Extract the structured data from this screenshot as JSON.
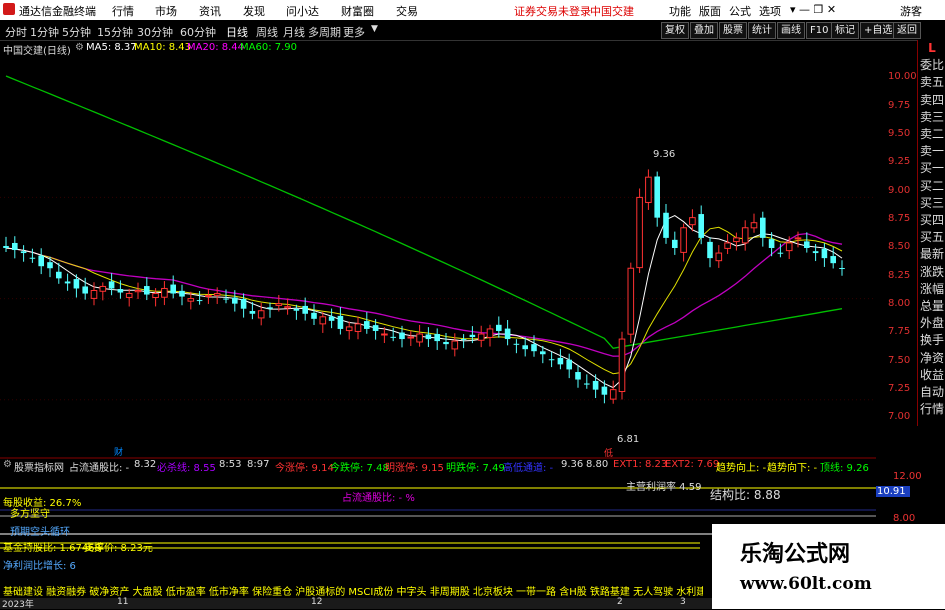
{
  "titlebar": {
    "app_name": "通达信金融终端",
    "menu": [
      "行情",
      "市场",
      "资讯",
      "发现",
      "问小达",
      "财富圈",
      "交易"
    ],
    "notice": "证券交易未登录",
    "stock_name_top": "中国交建",
    "right_menu": [
      "功能",
      "版面",
      "公式",
      "选项"
    ],
    "guest": "游客"
  },
  "timeframes": [
    "分时",
    "1分钟",
    "5分钟",
    "15分钟",
    "30分钟",
    "60分钟",
    "日线",
    "周线",
    "月线",
    "多周期",
    "更多"
  ],
  "toolbar_buttons": [
    "复权",
    "叠加",
    "股票",
    "统计",
    "画线",
    "F10",
    "标记",
    "+自选",
    "返回"
  ],
  "chart": {
    "title": "中国交建(日线)",
    "ma5": "MA5: 8.37",
    "ma10": "MA10: 8.43",
    "ma20": "MA20: 8.44",
    "ma60": "MA60: 7.90",
    "high_label": "9.36",
    "low_label": "6.81",
    "low_marker": "低",
    "event_marker": "财",
    "price_ticks": [
      "10.00",
      "9.75",
      "9.50",
      "9.25",
      "9.00",
      "8.75",
      "8.50",
      "8.25",
      "8.00",
      "7.75",
      "7.50",
      "7.25",
      "7.00"
    ]
  },
  "sidebar_buttons": [
    "L",
    "委比",
    "卖五",
    "卖四",
    "卖三",
    "卖二",
    "卖一",
    "买一",
    "买二",
    "买三",
    "买四",
    "买五",
    "最新",
    "涨跌",
    "涨幅",
    "总量",
    "外盘",
    "换手",
    "净资",
    "收益",
    "自动",
    "行情"
  ],
  "indicator": {
    "name": "股票指标网",
    "main_label": "占流通股比: -",
    "v1": "8.32",
    "bs_label": "必杀线: 8.55",
    "v2": "8:53",
    "v3": "8:97",
    "zt": "今涨停: 9.14",
    "dt": "今跌停: 7.48",
    "mzt": "明涨停: 9.15",
    "mdt": "明跌停: 7.49",
    "hl": "高低通道: -",
    "v4": "9.36",
    "v5": "8.80",
    "ext1": "EXT1: 8.23",
    "ext2": "EXT2: 7.69",
    "up": "趋势向上: -",
    "down": "趋势向下: -",
    "zline": "顶线: 9.26",
    "axis_12": "12.00",
    "axis_current": "10.91",
    "axis_8": "8.00",
    "zhanbi": "占流通股比: - %",
    "main_profit": "主营利润率 4.59",
    "jiegou": "结构比: 8.88",
    "shouyi": "每股收益: 26.7%",
    "duofang": "多方坚守",
    "yuanqi": "预期空头循环",
    "jijin": "基金持股比: 1.67468",
    "zhicheng": "支撑价: 8.23元",
    "jingli": "净利润比增长: 6",
    "concepts": "基础建设 融资融券 破净资产 大盘股 低市盈率 低市净率 保险重仓 沪股通标的 MSCI成份 中字头 非周期股 北京板块 一带一路 含H股 铁路基建 无人驾驶 水利建设 中特估"
  },
  "bottom_axis": [
    "2023年",
    "11",
    "12",
    "2",
    "3"
  ],
  "watermark": {
    "title": "乐淘公式网",
    "url": "www.60lt.com"
  },
  "chart_data": {
    "type": "candlestick",
    "title": "中国交建(日线)",
    "ylim": [
      6.8,
      10.2
    ],
    "high": 9.36,
    "low": 6.81,
    "ma_last": {
      "MA5": 8.37,
      "MA10": 8.43,
      "MA20": 8.44,
      "MA60": 7.9
    },
    "closes": [
      8.5,
      8.48,
      8.45,
      8.4,
      8.32,
      8.3,
      8.2,
      8.15,
      8.1,
      8.05,
      8.08,
      8.12,
      8.1,
      8.06,
      8.05,
      8.08,
      8.04,
      8.05,
      8.1,
      8.05,
      8.02,
      8.0,
      7.98,
      8.03,
      8.05,
      8.0,
      7.95,
      7.9,
      7.85,
      7.88,
      7.9,
      7.95,
      7.92,
      7.88,
      7.85,
      7.8,
      7.82,
      7.78,
      7.7,
      7.72,
      7.75,
      7.7,
      7.68,
      7.65,
      7.62,
      7.6,
      7.62,
      7.65,
      7.6,
      7.58,
      7.55,
      7.58,
      7.6,
      7.62,
      7.65,
      7.7,
      7.68,
      7.6,
      7.55,
      7.5,
      7.48,
      7.45,
      7.4,
      7.35,
      7.3,
      7.2,
      7.15,
      7.1,
      7.05,
      7.1,
      7.6,
      8.3,
      9.0,
      9.2,
      8.8,
      8.6,
      8.5,
      8.7,
      8.8,
      8.6,
      8.4,
      8.45,
      8.55,
      8.6,
      8.7,
      8.75,
      8.6,
      8.5,
      8.45,
      8.55,
      8.6,
      8.5,
      8.45,
      8.4,
      8.35,
      8.3
    ],
    "colors": {
      "up": "#ff3232",
      "down": "#54ffff",
      "ma5": "#ffffff",
      "ma10": "#ffff00",
      "ma20": "#ff00ff",
      "ma60": "#00ff00"
    }
  }
}
